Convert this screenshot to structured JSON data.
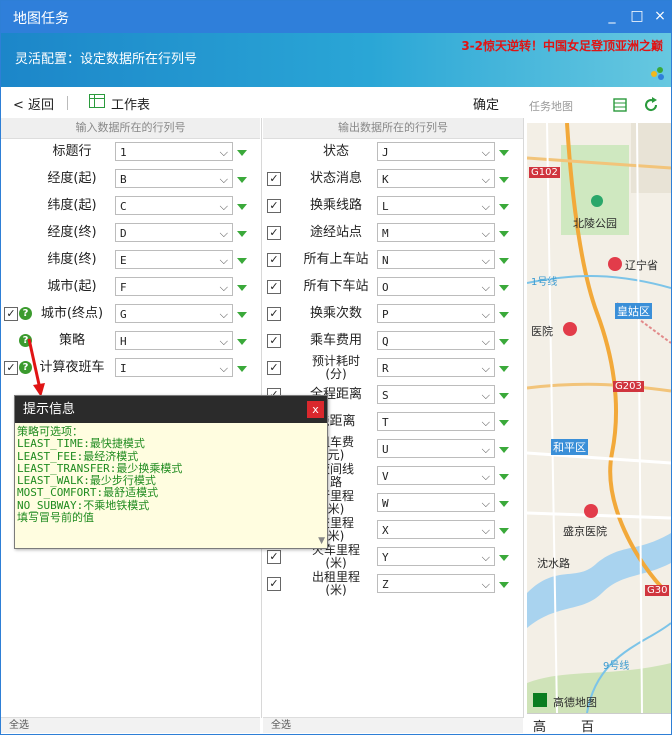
{
  "window": {
    "title": "地图任务",
    "controls": [
      "_",
      "□",
      "×"
    ]
  },
  "banner": {
    "config_text": "灵活配置：设定数据所在行列号",
    "news": "3-2惊天逆转！中国女足登顶亚洲之巅"
  },
  "toolbar": {
    "back": "< 返回",
    "worksheet": "工作表",
    "confirm": "确定"
  },
  "left": {
    "header": "输入数据所在的行列号",
    "rows": [
      {
        "label": "标题行",
        "value": "1",
        "checkbox": false,
        "help": false
      },
      {
        "label": "经度(起)",
        "value": "B",
        "checkbox": false,
        "help": false
      },
      {
        "label": "纬度(起)",
        "value": "C",
        "checkbox": false,
        "help": false
      },
      {
        "label": "经度(终)",
        "value": "D",
        "checkbox": false,
        "help": false
      },
      {
        "label": "纬度(终)",
        "value": "E",
        "checkbox": false,
        "help": false
      },
      {
        "label": "城市(起)",
        "value": "F",
        "checkbox": false,
        "help": false
      },
      {
        "label": "城市(终点)",
        "value": "G",
        "checkbox": true,
        "help": true
      },
      {
        "label": "策略",
        "value": "H",
        "checkbox": false,
        "help": true
      },
      {
        "label": "计算夜班车",
        "value": "I",
        "checkbox": true,
        "help": true
      }
    ],
    "footer": "全选"
  },
  "right": {
    "header": "输出数据所在的行列号",
    "rows": [
      {
        "label": "状态",
        "value": "J",
        "checkbox": false
      },
      {
        "label": "状态消息",
        "value": "K",
        "checkbox": true
      },
      {
        "label": "换乘线路",
        "value": "L",
        "checkbox": true
      },
      {
        "label": "途经站点",
        "value": "M",
        "checkbox": true
      },
      {
        "label": "所有上车站",
        "value": "N",
        "checkbox": true
      },
      {
        "label": "所有下车站",
        "value": "O",
        "checkbox": true
      },
      {
        "label": "换乘次数",
        "value": "P",
        "checkbox": true
      },
      {
        "label": "乘车费用",
        "value": "Q",
        "checkbox": true
      },
      {
        "label": "预计耗时\n(分)",
        "value": "R",
        "checkbox": true
      },
      {
        "label": "全程距离",
        "value": "S",
        "checkbox": true
      },
      {
        "label": "线距离",
        "value": "T",
        "checkbox": true
      },
      {
        "label": "租车费\n元)",
        "value": "U",
        "checkbox": true
      },
      {
        "label": "夜间线\n路",
        "value": "V",
        "checkbox": true
      },
      {
        "label": "行里程\n米)",
        "value": "W",
        "checkbox": true
      },
      {
        "label": "交里程\n米)",
        "value": "X",
        "checkbox": true
      },
      {
        "label": "火车里程\n(米)",
        "value": "Y",
        "checkbox": true
      },
      {
        "label": "出租里程\n(米)",
        "value": "Z",
        "checkbox": true
      }
    ],
    "footer": "全选"
  },
  "tooltip": {
    "title": "提示信息",
    "close": "x",
    "text": "策略可选项：\nLEAST_TIME:最快捷模式\nLEAST_FEE:最经济模式\nLEAST_TRANSFER:最少换乘模式\nLEAST_WALK:最少步行模式\nMOST_COMFORT:最舒适模式\nNO_SUBWAY:不乘地铁模式\n填写冒号前的值"
  },
  "map": {
    "title": "任务地图",
    "labels": [
      "G102",
      "北陵公园",
      "辽宁省",
      "1号线",
      "皇姑区",
      "医院",
      "G203",
      "和平区",
      "盛京医院",
      "沈水路",
      "G30",
      "9号线",
      "高德地图"
    ],
    "tabs": [
      "高",
      "百"
    ]
  },
  "colors": {
    "accent": "#2f7fda",
    "green": "#3aa93a",
    "news_red": "#e01414",
    "tip_text": "#1f8b1f"
  }
}
